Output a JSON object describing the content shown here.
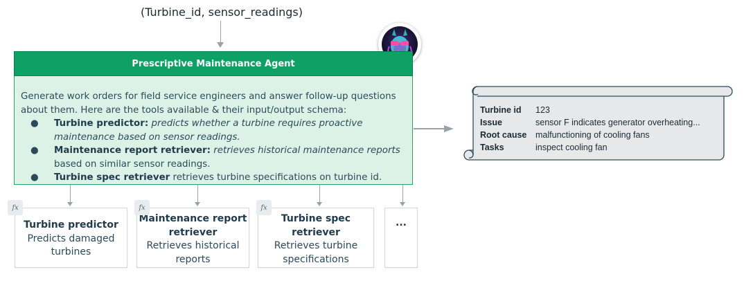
{
  "input_label": "(Turbine_id, sensor_readings)",
  "agent": {
    "title": "Prescriptive Maintenance Agent",
    "description": "Generate work orders for field service engineers and answer follow-up questions about them. Here are the tools available & their input/output schema:",
    "tools_list": [
      {
        "bullet": "●",
        "name": "Turbine predictor:",
        "desc": "predicts whether a turbine requires proactive maintenance based on sensor readings.",
        "desc_rest": ""
      },
      {
        "bullet": "●",
        "name": "Maintenance report retriever:",
        "desc": "retrieves historical maintenance reports",
        "desc_rest": "based on similar sensor readings."
      },
      {
        "bullet": "●",
        "name": "Turbine spec retriever",
        "desc": "",
        "desc_rest": "retrieves turbine specifications on turbine id."
      }
    ]
  },
  "tools": [
    {
      "icon": "fx",
      "title": "Turbine predictor",
      "subtitle": "Predicts damaged turbines"
    },
    {
      "icon": "fx",
      "title": "Maintenance report retriever",
      "subtitle": "Retrieves historical reports"
    },
    {
      "icon": "fx",
      "title": "Turbine spec retriever",
      "subtitle": "Retrieves turbine specifications"
    },
    {
      "title": "..."
    }
  ],
  "work_order": {
    "rows": [
      {
        "key": "Turbine id",
        "value": "123"
      },
      {
        "key": "Issue",
        "value": "sensor F indicates generator overheating..."
      },
      {
        "key": "Root cause",
        "value": "malfunctioning  of cooling fans"
      },
      {
        "key": "Tasks",
        "value": "inspect cooling fan"
      }
    ]
  },
  "colors": {
    "header_green": "#0fa065",
    "body_green": "#ddf2e6",
    "scroll_fill": "#e7e8e9"
  }
}
